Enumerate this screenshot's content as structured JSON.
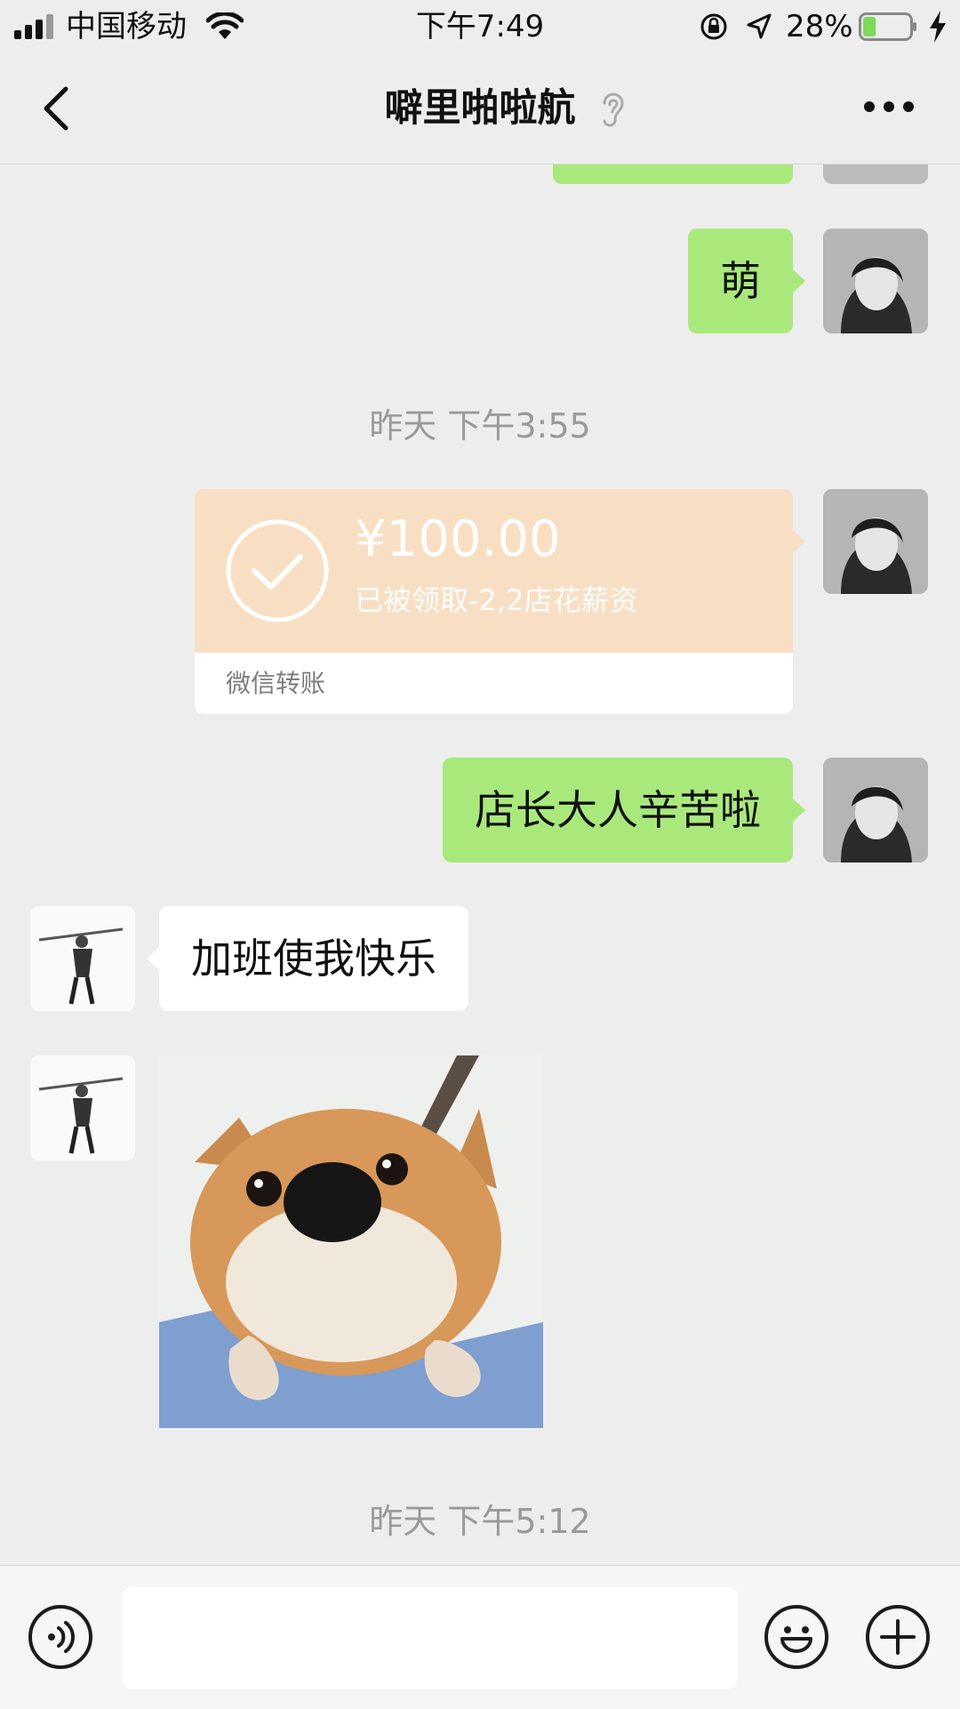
{
  "status_bar": {
    "carrier": "中国移动",
    "time": "下午7:49",
    "battery_percent": "28%",
    "battery_level": 0.28
  },
  "nav": {
    "title": "噼里啪啦航",
    "back_icon": "chevron-left-icon",
    "more_icon": "more-dots-icon",
    "earpiece_icon": "ear-icon"
  },
  "messages": {
    "m1_text": "萌",
    "ts1": "昨天 下午3:55",
    "transfer": {
      "amount": "¥100.00",
      "status": "已被领取-2,2店花薪资",
      "label": "微信转账"
    },
    "m2_text": "店长大人辛苦啦",
    "m3_text": "加班使我快乐",
    "ts2": "昨天 下午5:12"
  },
  "input_bar": {
    "voice_icon": "voice-icon",
    "emoji_icon": "emoji-icon",
    "plus_icon": "plus-icon",
    "input_value": ""
  },
  "colors": {
    "background": "#ededed",
    "my_bubble": "#a9e97c",
    "transfer_card": "#f8dfc4",
    "battery_fill": "#7ed957"
  }
}
